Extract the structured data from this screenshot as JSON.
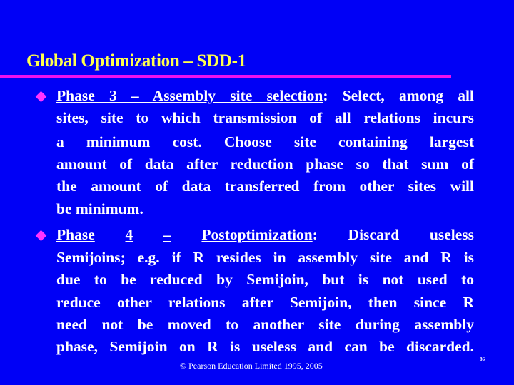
{
  "slide": {
    "title": "Global Optimization – SDD-1",
    "colors": {
      "background": "#0000f6",
      "title": "#ffff4d",
      "rule": "#ee11ee",
      "bullet": "#ff33ff",
      "text": "#ffffff"
    },
    "bullets": [
      {
        "heading": "Phase 3 – Assembly site selection",
        "lines": [
          {
            "pre": "Phase 3 – Assembly site selection",
            "post": ": Select, among all"
          },
          {
            "text": "sites, site to which transmission of all relations incurs"
          },
          {
            "text": "a minimum cost. Choose site containing largest"
          },
          {
            "text": "amount of data after reduction phase so that sum of"
          },
          {
            "text": "the amount of data transferred from other sites will"
          },
          {
            "text": "be minimum."
          }
        ]
      },
      {
        "heading": "Phase 4 – Postoptimization",
        "lines": [
          {
            "pre": "Phase 4 – Postoptimization",
            "post": ": Discard useless"
          },
          {
            "text": "Semijoins; e.g. if R resides in assembly site and R is"
          },
          {
            "text": "due to be reduced by Semijoin, but is not used to"
          },
          {
            "text": "reduce other relations after Semijoin, then since R"
          },
          {
            "text": "need not be moved to another site during assembly"
          },
          {
            "text": "phase, Semijoin on R is useless and can be discarded."
          }
        ]
      }
    ],
    "footer": "© Pearson Education Limited 1995, 2005",
    "page_number": "86"
  }
}
